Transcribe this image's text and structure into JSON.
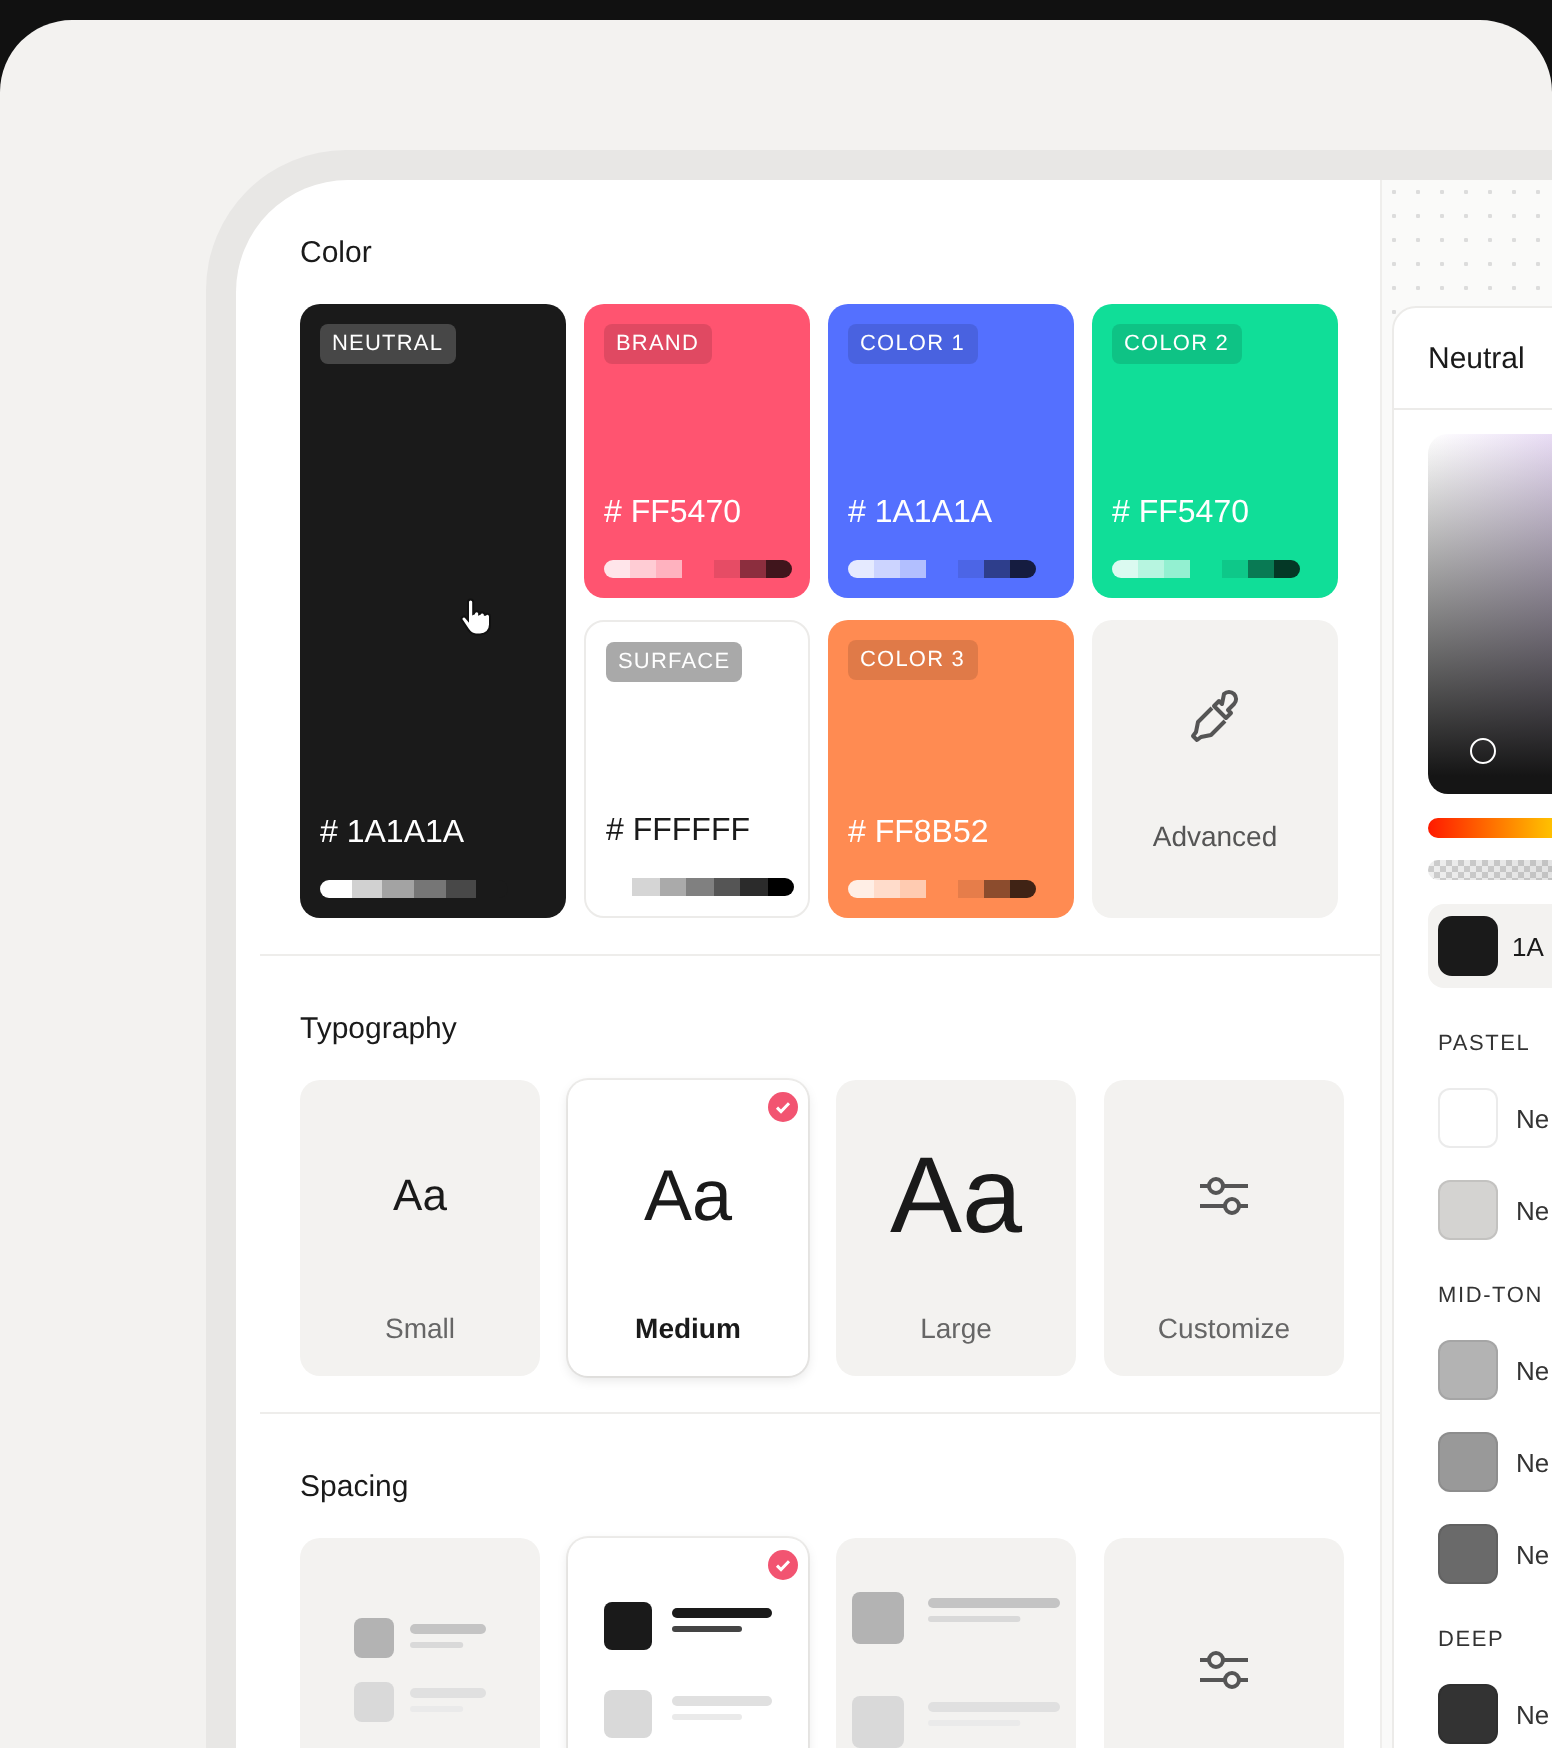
{
  "color": {
    "title": "Color",
    "cards": [
      {
        "kind": "dark",
        "tag": "NEUTRAL",
        "hex": "# 1A1A1A",
        "color": "#1a1a1a"
      },
      {
        "kind": "color",
        "tag": "BRAND",
        "hex": "# FF5470",
        "color": "#ff5470"
      },
      {
        "kind": "color",
        "tag": "COLOR 1",
        "hex": "# 1A1A1A",
        "color": "#5470ff"
      },
      {
        "kind": "color",
        "tag": "COLOR 2",
        "hex": "# FF5470",
        "color": "#10de98"
      },
      {
        "kind": "light",
        "tag": "SURFACE",
        "hex": "# FFFFFF",
        "color": "#ffffff"
      },
      {
        "kind": "color",
        "tag": "COLOR 3",
        "hex": "# FF8B52",
        "color": "#ff8b52"
      },
      {
        "kind": "advanced",
        "label": "Advanced"
      }
    ]
  },
  "typography": {
    "title": "Typography",
    "options": [
      {
        "kind": "small",
        "sample": "Aa",
        "label": "Small",
        "selected": false
      },
      {
        "kind": "medium",
        "sample": "Aa",
        "label": "Medium",
        "selected": true
      },
      {
        "kind": "large",
        "sample": "Aa",
        "label": "Large",
        "selected": false
      },
      {
        "kind": "customize",
        "label": "Customize",
        "selected": false
      }
    ]
  },
  "spacing": {
    "title": "Spacing",
    "options": [
      {
        "kind": "compact",
        "selected": false
      },
      {
        "kind": "medium",
        "selected": true
      },
      {
        "kind": "loose",
        "selected": false
      },
      {
        "kind": "customize",
        "selected": false
      }
    ]
  },
  "editor": {
    "title": "Neutral",
    "hue": {
      "level": 0.78
    },
    "opacity": {
      "level": 1
    },
    "current": {
      "value": "1A",
      "color": "#1a1a1a"
    },
    "groups": [
      {
        "title": "PASTEL",
        "swatches": [
          {
            "label": "Ne",
            "color": "#ffffff"
          },
          {
            "label": "Ne",
            "color": "#d4d3d1"
          }
        ]
      },
      {
        "title": "MID-TON",
        "swatches": [
          {
            "label": "Ne",
            "color": "#b3b3b3"
          },
          {
            "label": "Ne",
            "color": "#999999"
          },
          {
            "label": "Ne",
            "color": "#6a6a6a"
          }
        ]
      },
      {
        "title": "DEEP",
        "swatches": [
          {
            "label": "Ne",
            "color": "#333333"
          }
        ]
      }
    ]
  }
}
